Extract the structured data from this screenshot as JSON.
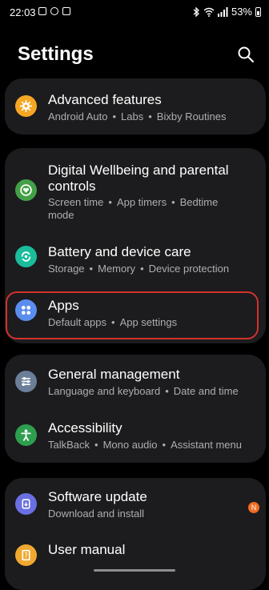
{
  "status_bar": {
    "time": "22:03",
    "battery": "53%"
  },
  "header": {
    "title": "Settings"
  },
  "items": {
    "advanced": {
      "title": "Advanced features",
      "subtitle": [
        "Android Auto",
        "Labs",
        "Bixby Routines"
      ]
    },
    "wellbeing": {
      "title_line1": "Digital Wellbeing and parental",
      "title_line2": "controls",
      "subtitle_line1": [
        "Screen time",
        "App timers",
        "Bedtime"
      ],
      "subtitle_line2": "mode"
    },
    "battery": {
      "title": "Battery and device care",
      "subtitle": [
        "Storage",
        "Memory",
        "Device protection"
      ]
    },
    "apps": {
      "title": "Apps",
      "subtitle": [
        "Default apps",
        "App settings"
      ]
    },
    "general": {
      "title": "General management",
      "subtitle": [
        "Language and keyboard",
        "Date and time"
      ]
    },
    "accessibility": {
      "title": "Accessibility",
      "subtitle": [
        "TalkBack",
        "Mono audio",
        "Assistant menu"
      ]
    },
    "software": {
      "title": "Software update",
      "subtitle": [
        "Download and install"
      ],
      "badge": "N"
    },
    "manual": {
      "title": "User manual"
    }
  },
  "colors": {
    "advanced_icon": "#f5a623",
    "wellbeing_icon": "#43a047",
    "battery_icon": "#1abc9c",
    "apps_icon": "#5b8def",
    "general_icon": "#6b7f99",
    "accessibility_icon": "#2e9e4f",
    "software_icon": "#6a6fe3",
    "manual_icon": "#f0a830",
    "highlight": "#d3312b",
    "badge": "#f16b22"
  },
  "icons": {
    "advanced": "gear-star-icon",
    "wellbeing": "heart-circle-icon",
    "battery": "refresh-circle-icon",
    "apps": "apps-grid-icon",
    "general": "sliders-icon",
    "accessibility": "person-icon",
    "software": "update-icon",
    "manual": "book-icon",
    "search": "search-icon"
  }
}
